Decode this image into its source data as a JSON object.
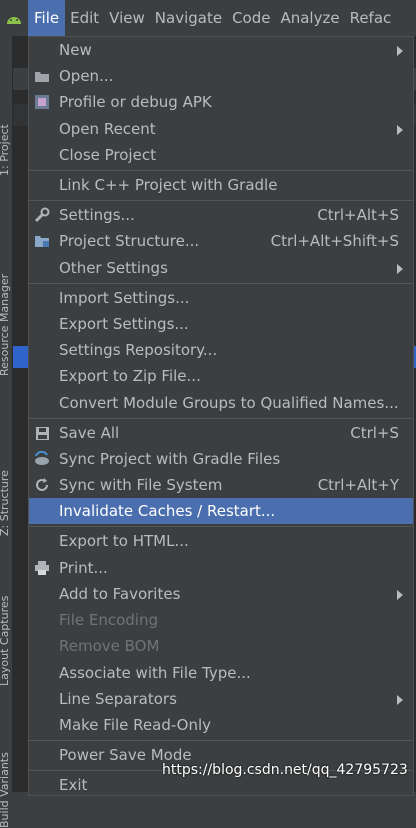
{
  "menubar": {
    "items": [
      {
        "label": "File",
        "active": true
      },
      {
        "label": "Edit"
      },
      {
        "label": "View"
      },
      {
        "label": "Navigate"
      },
      {
        "label": "Code"
      },
      {
        "label": "Analyze"
      },
      {
        "label": "Refac"
      }
    ]
  },
  "sidebar": {
    "tabs": [
      "1: Project",
      "Resource Manager",
      "Z: Structure",
      "Layout Captures",
      "Build Variants"
    ]
  },
  "file_menu": {
    "items": [
      {
        "label": "New",
        "submenu": true
      },
      {
        "label": "Open...",
        "icon": "folder-icon"
      },
      {
        "label": "Profile or debug APK",
        "icon": "apk-icon"
      },
      {
        "label": "Open Recent",
        "submenu": true
      },
      {
        "label": "Close Project"
      },
      {
        "label": "Link C++ Project with Gradle"
      },
      {
        "label": "Settings...",
        "shortcut": "Ctrl+Alt+S",
        "icon": "wrench-icon"
      },
      {
        "label": "Project Structure...",
        "shortcut": "Ctrl+Alt+Shift+S",
        "icon": "project-structure-icon"
      },
      {
        "label": "Other Settings",
        "submenu": true
      },
      {
        "label": "Import Settings..."
      },
      {
        "label": "Export Settings..."
      },
      {
        "label": "Settings Repository..."
      },
      {
        "label": "Export to Zip File..."
      },
      {
        "label": "Convert Module Groups to Qualified Names..."
      },
      {
        "label": "Save All",
        "shortcut": "Ctrl+S",
        "icon": "save-icon"
      },
      {
        "label": "Sync Project with Gradle Files",
        "icon": "gradle-sync-icon"
      },
      {
        "label": "Sync with File System",
        "shortcut": "Ctrl+Alt+Y",
        "icon": "refresh-icon"
      },
      {
        "label": "Invalidate Caches / Restart...",
        "selected": true
      },
      {
        "label": "Export to HTML..."
      },
      {
        "label": "Print...",
        "icon": "printer-icon"
      },
      {
        "label": "Add to Favorites",
        "submenu": true
      },
      {
        "label": "File Encoding",
        "disabled": true
      },
      {
        "label": "Remove BOM",
        "disabled": true
      },
      {
        "label": "Associate with File Type..."
      },
      {
        "label": "Line Separators",
        "submenu": true
      },
      {
        "label": "Make File Read-Only"
      },
      {
        "label": "Power Save Mode"
      },
      {
        "label": "Exit"
      }
    ]
  },
  "watermark": "https://blog.csdn.net/qq_42795723",
  "colors": {
    "selection": "#4b6eaf",
    "background": "#3c3f41",
    "text": "#bbbbbb"
  }
}
